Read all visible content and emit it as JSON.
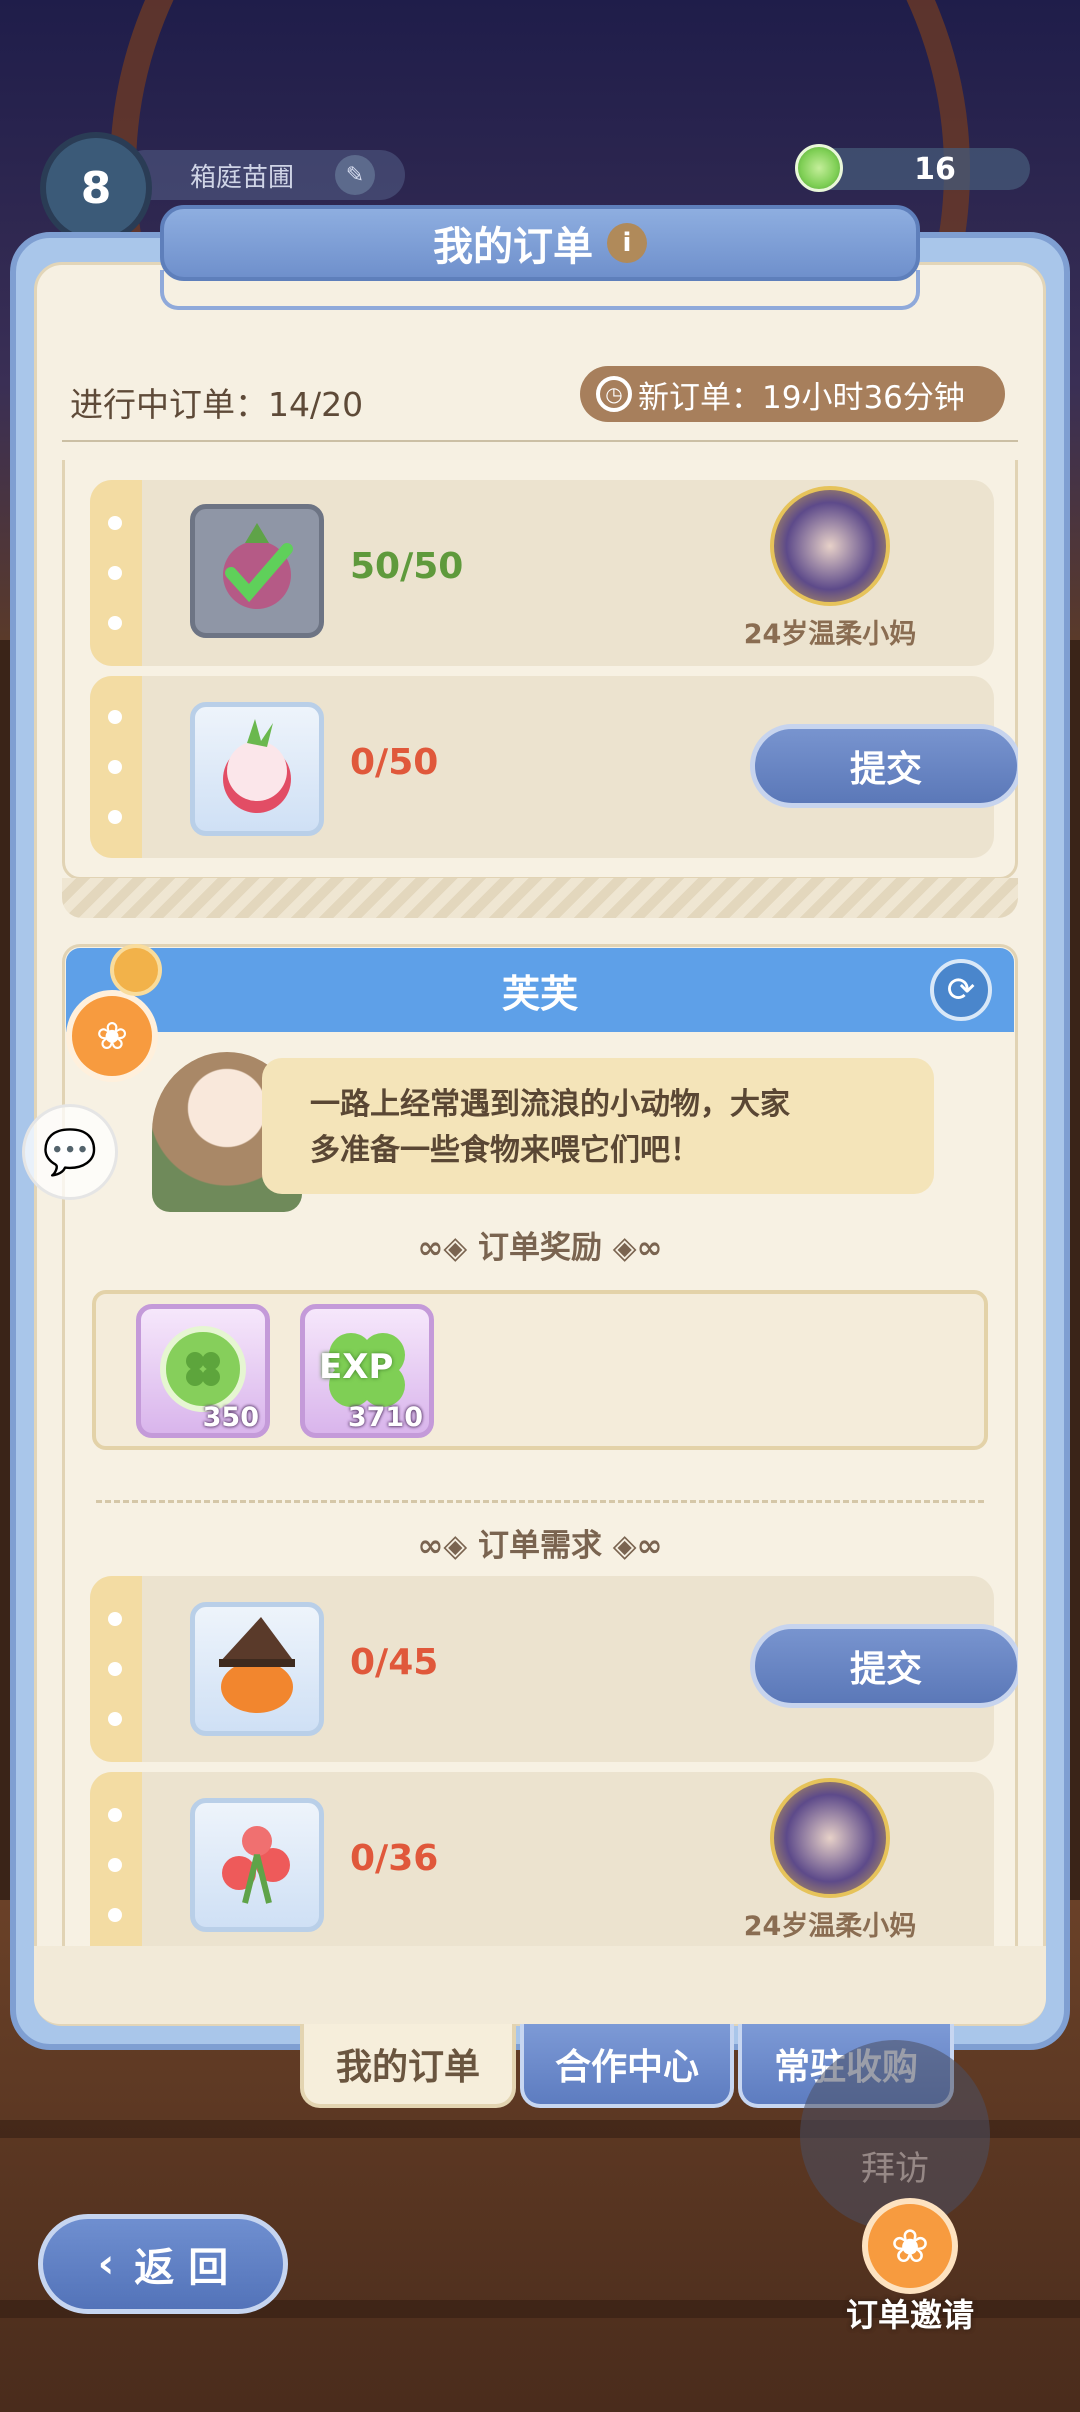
{
  "hud": {
    "level": "8",
    "farm_name": "箱庭苗圃",
    "farm_id": "9000000",
    "coins": "16",
    "coin_icon": "clover-coin-icon"
  },
  "panel": {
    "title": "我的订单",
    "progress_label": "进行中订单：14/20",
    "new_order_timer": "新订单：19小时36分钟"
  },
  "prev_order": {
    "rows": [
      {
        "item_icon": "radish-icon",
        "count": "50/50",
        "status": "complete",
        "helper_name": "24岁温柔小妈"
      },
      {
        "item_icon": "radish-icon",
        "count": "0/50",
        "status": "pending",
        "action": "提交"
      }
    ]
  },
  "order": {
    "npc_name": "芙芙",
    "dialogue_line1": "一路上经常遇到流浪的小动物，大家",
    "dialogue_line2": "多准备一些食物来喂它们吧！",
    "rewards_title": "订单奖励",
    "rewards": [
      {
        "icon": "clover-coin-icon",
        "count": "350"
      },
      {
        "icon": "exp-clover-icon",
        "label": "EXP",
        "count": "3710"
      }
    ],
    "requirements_title": "订单需求",
    "requirements": [
      {
        "item_icon": "witch-pumpkin-icon",
        "count": "0/45",
        "action": "提交"
      },
      {
        "item_icon": "red-bell-flower-icon",
        "count": "0/36",
        "helper_name": "24岁温柔小妈"
      }
    ]
  },
  "tabs": [
    {
      "label": "我的订单",
      "active": true
    },
    {
      "label": "合作中心",
      "active": false
    },
    {
      "label": "常驻收购",
      "active": false
    }
  ],
  "footer": {
    "back_label": "返 回",
    "visit_label": "拜访",
    "invite_label": "订单邀请"
  },
  "colors": {
    "accent_blue": "#5ea0e8",
    "button_blue": "#5b78b8",
    "pending_red": "#e0583b",
    "done_green": "#5f9a3c",
    "timer_brown": "#a77f5c"
  }
}
